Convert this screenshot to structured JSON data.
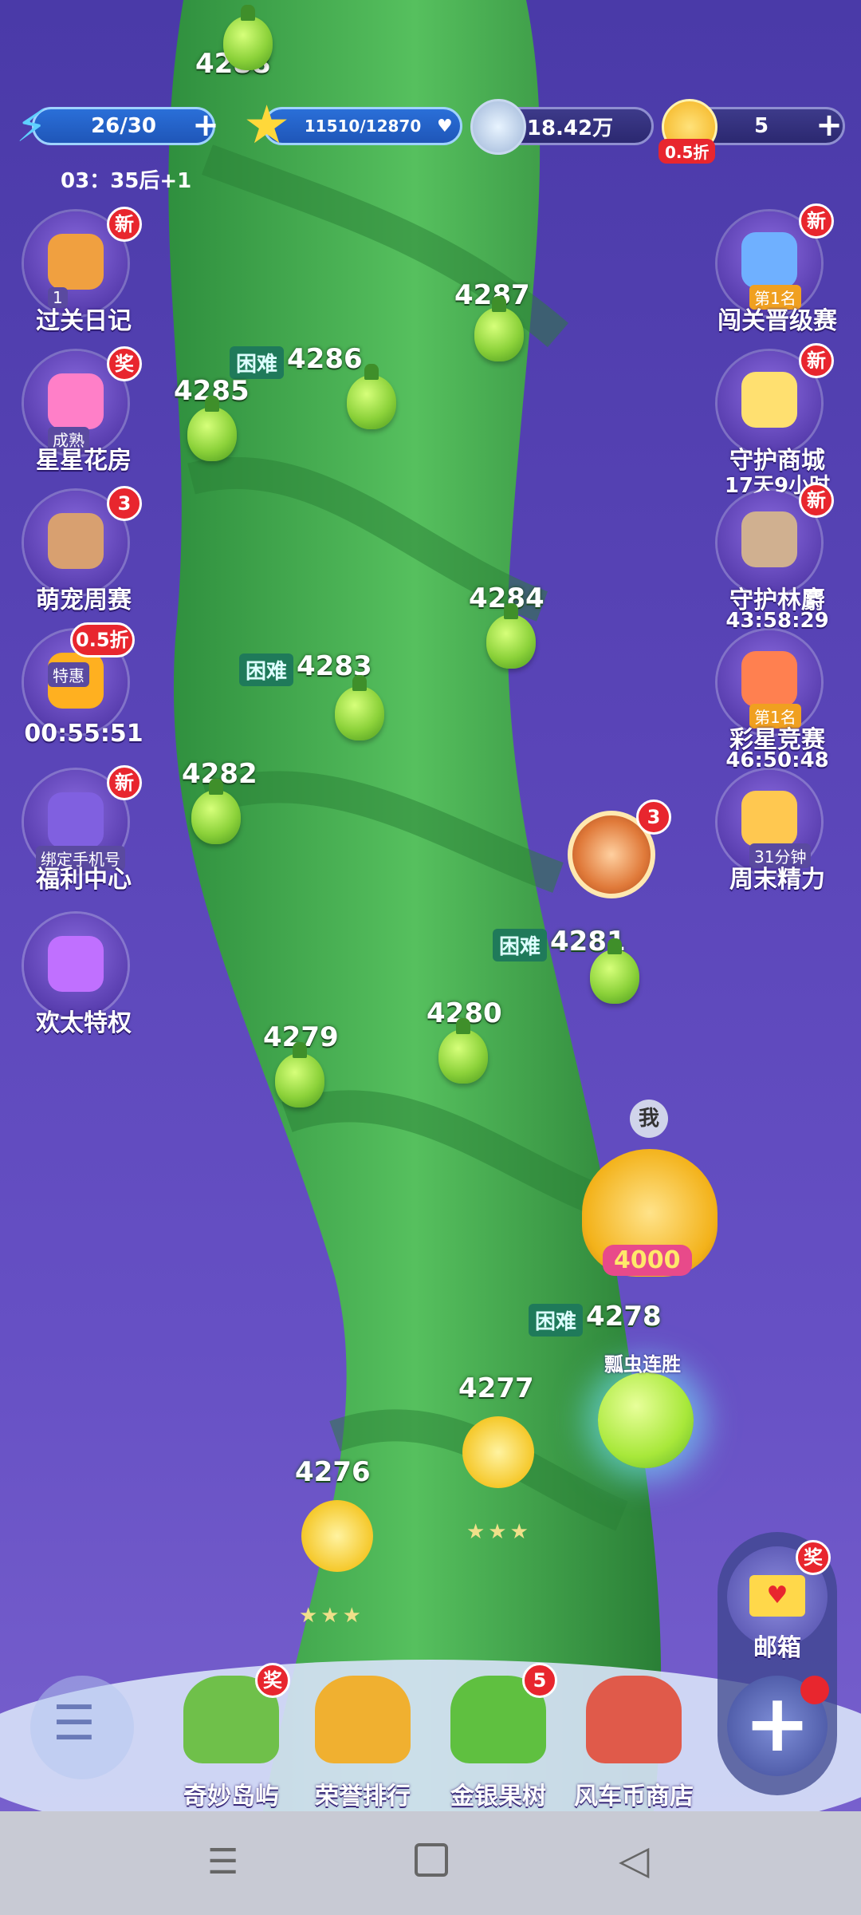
{
  "hud": {
    "energy": "26/30",
    "stars": "11510/12870",
    "coins": "18.42万",
    "tickets": "5",
    "ticket_discount": "0.5折",
    "energy_timer": "03：35后+1"
  },
  "levels": [
    {
      "num": "4288",
      "hard": false
    },
    {
      "num": "4287",
      "hard": false
    },
    {
      "num": "4286",
      "hard": true
    },
    {
      "num": "4285",
      "hard": false
    },
    {
      "num": "4284",
      "hard": false
    },
    {
      "num": "4283",
      "hard": true
    },
    {
      "num": "4282",
      "hard": false
    },
    {
      "num": "4281",
      "hard": true
    },
    {
      "num": "4280",
      "hard": false
    },
    {
      "num": "4279",
      "hard": false
    },
    {
      "num": "4278",
      "hard": true
    },
    {
      "num": "4277",
      "hard": false
    },
    {
      "num": "4276",
      "hard": false
    }
  ],
  "hard_label": "困难",
  "left_menu": [
    {
      "label": "过关日记",
      "badge": "新",
      "sub": "1"
    },
    {
      "label": "星星花房",
      "badge": "奖",
      "sub": "成熟"
    },
    {
      "label": "萌宠周赛",
      "badge": "3",
      "sub": ""
    },
    {
      "label": "00:55:51",
      "badge": "0.5折",
      "sub": "特惠"
    },
    {
      "label": "福利中心",
      "badge": "新",
      "sub": "绑定手机号"
    },
    {
      "label": "欢太特权",
      "badge": "",
      "sub": ""
    }
  ],
  "right_menu": [
    {
      "label": "闯关晋级赛",
      "badge": "新",
      "sub": "第1名",
      "timer": ""
    },
    {
      "label": "守护商城",
      "badge": "新",
      "sub": "",
      "timer": "17天9小时"
    },
    {
      "label": "守护林麝",
      "badge": "新",
      "sub": "",
      "timer": "43:58:29"
    },
    {
      "label": "彩星竞赛",
      "badge": "",
      "sub": "第1名",
      "timer": "46:50:48"
    },
    {
      "label": "周末精力",
      "badge": "",
      "sub": "31分钟",
      "timer": ""
    }
  ],
  "wheel_badge": "3",
  "player": {
    "me": "我",
    "score": "4000"
  },
  "bonus_tag": "瓢虫连胜",
  "mail": {
    "label": "邮箱",
    "badge": "奖"
  },
  "bottom_nav": [
    {
      "label": "奇妙岛屿",
      "badge": "奖"
    },
    {
      "label": "荣誉排行",
      "badge": ""
    },
    {
      "label": "金银果树",
      "badge": "5"
    },
    {
      "label": "风车币商店",
      "badge": ""
    }
  ],
  "colors": {
    "background": "#5a45b8",
    "stalk": "#3fae4a",
    "badge": "#e8262e"
  }
}
